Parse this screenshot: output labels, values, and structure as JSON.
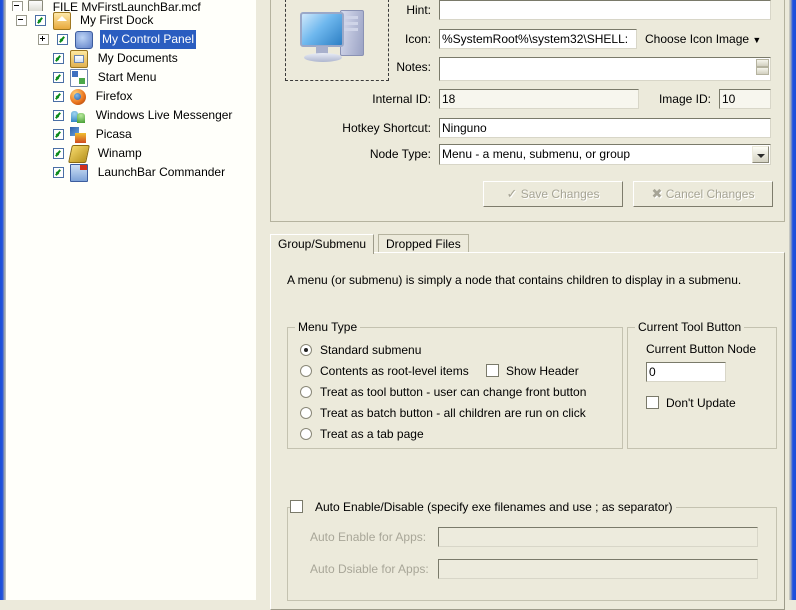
{
  "tree": {
    "root": {
      "label": "FILE MyFirstLaunchBar.mcf",
      "icon": "file-icon"
    },
    "items": [
      {
        "label": "My First Dock",
        "icon": "dock-icon",
        "indent": 1,
        "checked": true,
        "expander": "minus",
        "selected": false
      },
      {
        "label": "My Control Panel",
        "icon": "control-panel-icon",
        "indent": 2,
        "checked": true,
        "expander": "plus",
        "selected": true
      },
      {
        "label": "My Documents",
        "icon": "my-documents-icon",
        "indent": 2,
        "checked": true,
        "expander": "none",
        "selected": false
      },
      {
        "label": "Start Menu",
        "icon": "start-menu-icon",
        "indent": 2,
        "checked": true,
        "expander": "none",
        "selected": false
      },
      {
        "label": "Firefox",
        "icon": "firefox-icon",
        "indent": 2,
        "checked": true,
        "expander": "none",
        "selected": false
      },
      {
        "label": "Windows Live Messenger",
        "icon": "messenger-icon",
        "indent": 2,
        "checked": true,
        "expander": "none",
        "selected": false
      },
      {
        "label": "Picasa",
        "icon": "picasa-icon",
        "indent": 2,
        "checked": true,
        "expander": "none",
        "selected": false
      },
      {
        "label": "Winamp",
        "icon": "winamp-icon",
        "indent": 2,
        "checked": true,
        "expander": "none",
        "selected": false
      },
      {
        "label": "LaunchBar Commander",
        "icon": "launchbar-icon",
        "indent": 2,
        "checked": true,
        "expander": "none",
        "selected": false
      }
    ]
  },
  "properties": {
    "preview_icon_name": "computer-monitor-icon",
    "hint_label": "Hint:",
    "hint_value": "",
    "icon_label": "Icon:",
    "icon_value": "%SystemRoot%\\system32\\SHELL:",
    "choose_icon_button": "Choose Icon Image",
    "notes_label": "Notes:",
    "notes_value": "",
    "internal_id_label": "Internal ID:",
    "internal_id_value": "18",
    "image_id_label": "Image ID:",
    "image_id_value": "10",
    "hotkey_label": "Hotkey Shortcut:",
    "hotkey_value": "Ninguno",
    "node_type_label": "Node Type:",
    "node_type_value": "Menu - a menu, submenu, or group",
    "save_button": "Save Changes",
    "cancel_button": "Cancel Changes"
  },
  "tabs": [
    {
      "label": "Group/Submenu",
      "active": true
    },
    {
      "label": "Dropped Files",
      "active": false
    }
  ],
  "group_submenu": {
    "description": "A menu (or submenu) is simply a node that contains children to display in a submenu.",
    "menu_type": {
      "caption": "Menu Type",
      "options": [
        {
          "label": "Standard submenu",
          "selected": true
        },
        {
          "label": "Contents as root-level items",
          "selected": false
        },
        {
          "label": "Treat as tool button - user can change front button",
          "selected": false
        },
        {
          "label": "Treat as batch button - all children are run on click",
          "selected": false
        },
        {
          "label": "Treat as a tab page",
          "selected": false
        }
      ],
      "show_header_label": "Show Header",
      "show_header_checked": false
    },
    "current_tool_button": {
      "caption": "Current Tool Button",
      "node_label": "Current Button Node",
      "node_value": "0",
      "dont_update_label": "Don't Update",
      "dont_update_checked": false
    },
    "auto_enable": {
      "caption": "Auto Enable/Disable (specify exe filenames and use ; as separator)",
      "checked": false,
      "enable_label": "Auto Enable for Apps:",
      "enable_value": "",
      "disable_label": "Auto Dsiable for Apps:",
      "disable_value": ""
    }
  },
  "colors": {
    "window_frame": "#2050e0",
    "dialog_bg": "#ECEADB",
    "selection": "#2A5DC0",
    "field_bg": "#FFFFFF"
  }
}
